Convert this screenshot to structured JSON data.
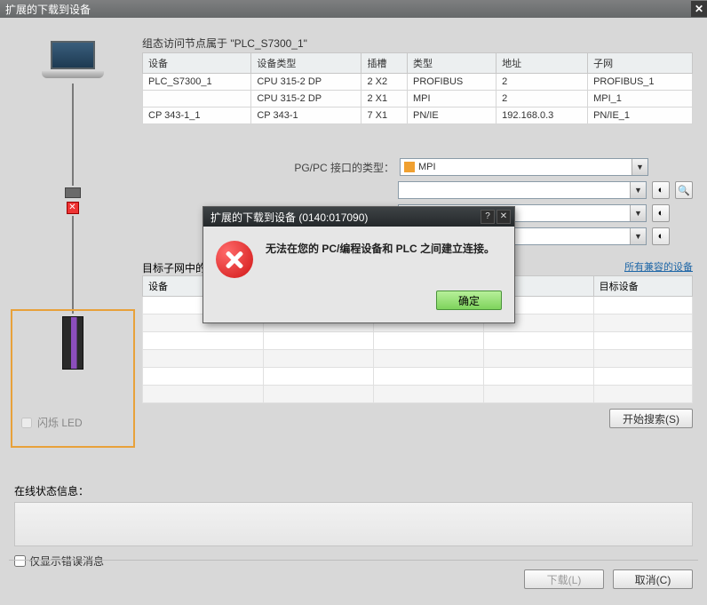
{
  "window": {
    "title": "扩展的下载到设备",
    "close": "✕"
  },
  "config": {
    "heading": "组态访问节点属于 \"PLC_S7300_1\"",
    "headers": {
      "device": "设备",
      "devtype": "设备类型",
      "slot": "插槽",
      "type": "类型",
      "addr": "地址",
      "subnet": "子网"
    },
    "rows": [
      {
        "device": "PLC_S7300_1",
        "devtype": "CPU 315-2 DP",
        "slot": "2 X2",
        "type": "PROFIBUS",
        "addr": "2",
        "subnet": "PROFIBUS_1"
      },
      {
        "device": "",
        "devtype": "CPU 315-2 DP",
        "slot": "2 X1",
        "type": "MPI",
        "addr": "2",
        "subnet": "MPI_1"
      },
      {
        "device": "CP 343-1_1",
        "devtype": "CP 343-1",
        "slot": "7 X1",
        "type": "PN/IE",
        "addr": "192.168.0.3",
        "subnet": "PN/IE_1"
      }
    ]
  },
  "form": {
    "pgpc_label": "PG/PC 接口的类型：",
    "pgpc_value": "MPI"
  },
  "target": {
    "heading_prefix": "目标子网中的",
    "link": "所有兼容的设备",
    "headers": {
      "device": "设备",
      "targetdev": "目标设备"
    }
  },
  "led": {
    "label": "闪烁 LED"
  },
  "buttons": {
    "start_search": "开始搜索(S)",
    "download": "下载(L)",
    "cancel": "取消(C)"
  },
  "status": {
    "heading": "在线状态信息：",
    "only_errors": "仅显示错误消息"
  },
  "modal": {
    "title": "扩展的下载到设备 (0140:017090)",
    "help": "?",
    "close": "✕",
    "message": "无法在您的 PC/编程设备和 PLC 之间建立连接。",
    "ok": "确定"
  }
}
